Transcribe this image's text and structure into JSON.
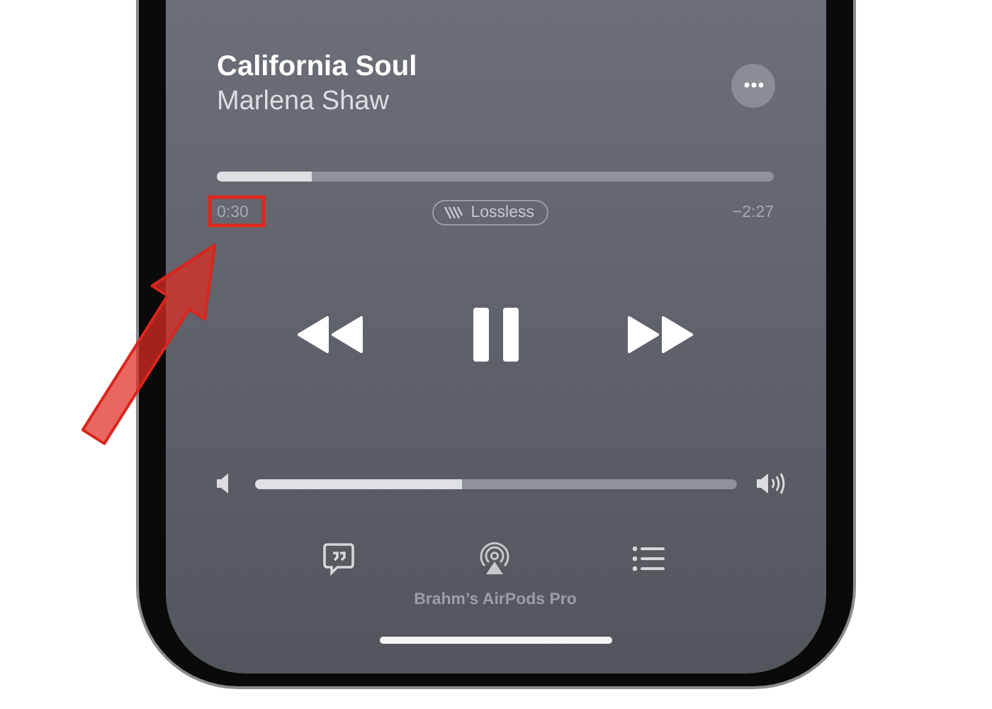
{
  "track": {
    "title": "California Soul",
    "artist": "Marlena Shaw"
  },
  "progress": {
    "level": 0.17,
    "elapsed": "0:30",
    "badge": "Lossless",
    "remaining": "−2:27"
  },
  "playback": {
    "playing": true
  },
  "volume": {
    "level": 0.43
  },
  "output_device": "Brahm’s AirPods Pro"
}
